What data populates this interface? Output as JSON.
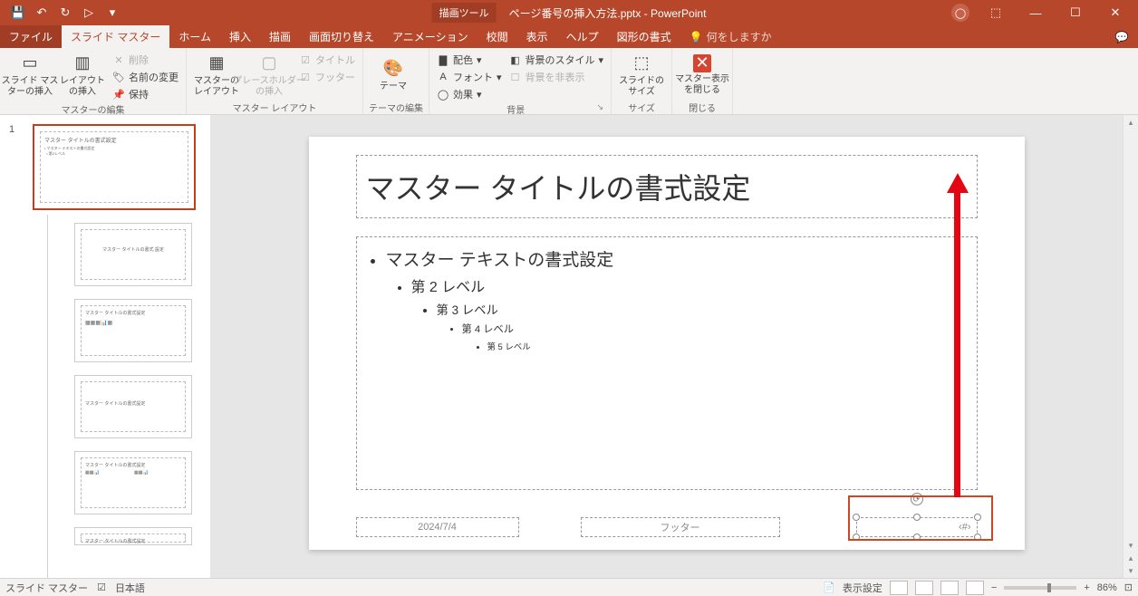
{
  "title": {
    "context_tab": "描画ツール",
    "filename": "ページ番号の挿入方法.pptx  -  PowerPoint"
  },
  "qat": {
    "save": "💾",
    "undo": "↶",
    "redo": "↻",
    "start": "▷",
    "more": "▾"
  },
  "winctrl": {
    "min": "—",
    "max": "☐",
    "close": "✕",
    "ribbon_opt": "⬚"
  },
  "tabs": {
    "file": "ファイル",
    "slide_master": "スライド マスター",
    "home": "ホーム",
    "insert": "挿入",
    "draw": "描画",
    "transitions": "画面切り替え",
    "animations": "アニメーション",
    "review": "校閲",
    "view": "表示",
    "help": "ヘルプ",
    "shape_format": "図形の書式",
    "tell_me": "何をしますか"
  },
  "ribbon": {
    "edit_master": {
      "label": "マスターの編集",
      "insert_slide_master": "スライド マス\nターの挿入",
      "insert_layout": "レイアウト\nの挿入",
      "delete": "削除",
      "rename": "名前の変更",
      "preserve": "保持"
    },
    "master_layout": {
      "label": "マスター レイアウト",
      "master_layout_btn": "マスターの\nレイアウト",
      "placeholder_insert": "プレースホルダー\nの挿入",
      "title_chk": "タイトル",
      "footer_chk": "フッター"
    },
    "edit_theme": {
      "label": "テーマの編集",
      "theme": "テーマ"
    },
    "background": {
      "label": "背景",
      "colors": "配色",
      "fonts": "フォント",
      "effects": "効果",
      "bg_styles": "背景のスタイル",
      "hide_bg": "背景を非表示"
    },
    "size": {
      "label": "サイズ",
      "slide_size": "スライドの\nサイズ"
    },
    "close": {
      "label": "閉じる",
      "close_master": "マスター表示\nを閉じる"
    }
  },
  "slide": {
    "title": "マスター タイトルの書式設定",
    "body_l1": "マスター テキストの書式設定",
    "body_l2": "第 2 レベル",
    "body_l3": "第 3 レベル",
    "body_l4": "第 4 レベル",
    "body_l5": "第 5 レベル",
    "date": "2024/7/4",
    "footer": "フッター",
    "pagenum": "‹#›"
  },
  "thumbs": {
    "number": "1",
    "master_title": "マスター タイトルの書式設定",
    "layout1": "マスター タイトルの書式\n設定",
    "layout2": "マスター タイトルの書式設定",
    "layout3": "マスター タイトルの書式設定",
    "layout4": "マスター タイトルの書式設定",
    "layout5": "マスター タイトルの書式設定"
  },
  "status": {
    "mode": "スライド マスター",
    "lang": "日本語",
    "display_settings": "表示設定",
    "zoom": "86%"
  }
}
